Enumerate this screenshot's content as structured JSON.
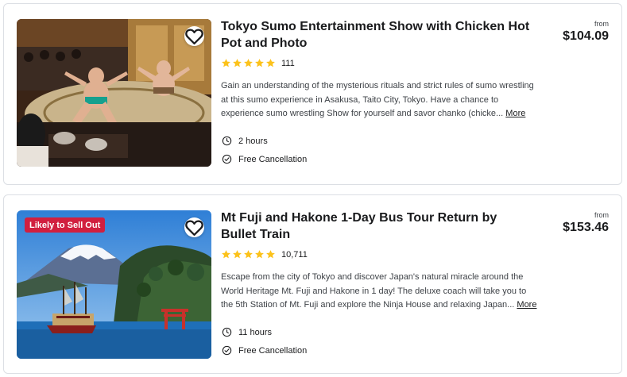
{
  "colors": {
    "star": "#fcc21b",
    "badge": "#d11f3f",
    "text_primary": "#1a1b1d",
    "text_secondary": "#3e4247",
    "border": "#dcdfe4"
  },
  "listings": [
    {
      "title": "Tokyo Sumo Entertainment Show with Chicken Hot Pot and Photo",
      "rating_stars": 5,
      "review_count": "111",
      "description": "Gain an understanding of the mysterious rituals and strict rules of sumo wrestling at this sumo experience in Asakusa, Taito City, Tokyo. Have a chance to experience sumo wrestling Show for yourself and savor chanko (chicke...",
      "more_label": "More",
      "duration": "2 hours",
      "cancellation": "Free Cancellation",
      "price_prefix": "from",
      "price": "$104.09",
      "image_icon": "sumo-show-photo",
      "badge": ""
    },
    {
      "title": "Mt Fuji and Hakone 1-Day Bus Tour Return by Bullet Train",
      "rating_stars": 5,
      "review_count": "10,711",
      "description": "Escape from the city of Tokyo and discover Japan's natural miracle around the World Heritage Mt. Fuji and Hakone in 1 day! The deluxe coach will take you to the 5th Station of Mt. Fuji and explore the Ninja House and relaxing Japan...",
      "more_label": "More",
      "duration": "11 hours",
      "cancellation": "Free Cancellation",
      "price_prefix": "from",
      "price": "$153.46",
      "image_icon": "mt-fuji-lake-photo",
      "badge": "Likely to Sell Out"
    }
  ]
}
